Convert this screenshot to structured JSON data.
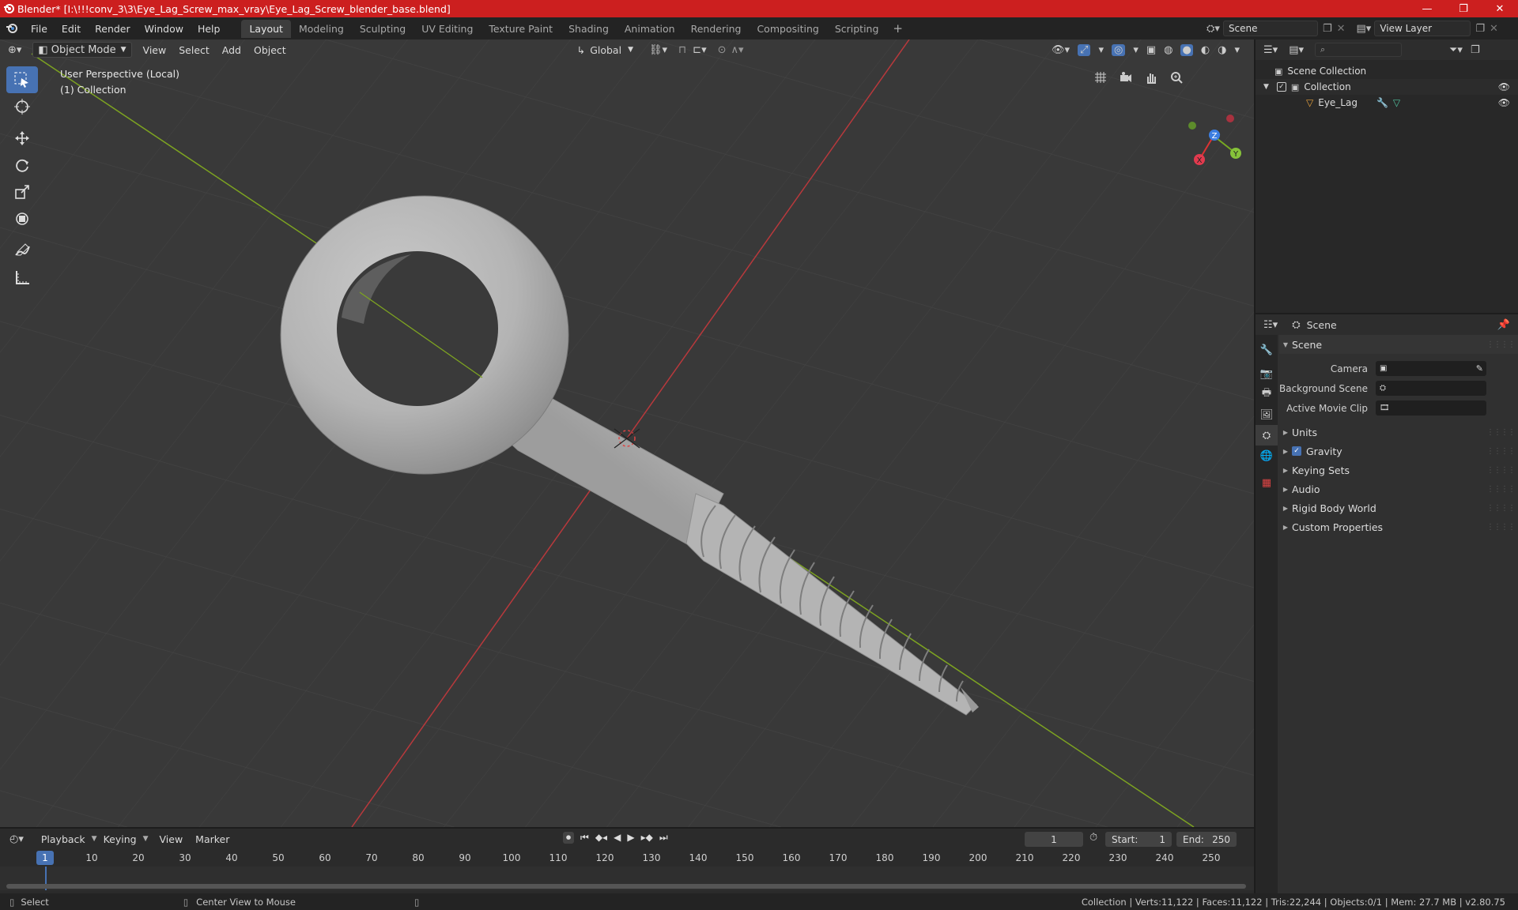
{
  "window": {
    "title": "Blender* [I:\\!!!conv_3\\3\\Eye_Lag_Screw_max_vray\\Eye_Lag_Screw_blender_base.blend]",
    "controls": [
      "—",
      "❐",
      "✕"
    ]
  },
  "menubar": {
    "menus": [
      "File",
      "Edit",
      "Render",
      "Window",
      "Help"
    ],
    "workspaces": [
      "Layout",
      "Modeling",
      "Sculpting",
      "UV Editing",
      "Texture Paint",
      "Shading",
      "Animation",
      "Rendering",
      "Compositing",
      "Scripting"
    ],
    "active_workspace": "Layout",
    "scene": "Scene",
    "view_layer": "View Layer"
  },
  "viewport": {
    "mode": "Object Mode",
    "menus": [
      "View",
      "Select",
      "Add",
      "Object"
    ],
    "orientation": "Global",
    "info_line1": "User Perspective (Local)",
    "info_line2": "(1) Collection",
    "gizmo": {
      "x": "X",
      "y": "Y",
      "z": "Z"
    }
  },
  "tools": [
    "select-box",
    "cursor",
    "move",
    "rotate",
    "scale",
    "transform",
    "annotate",
    "measure"
  ],
  "outliner": {
    "root": "Scene Collection",
    "collection": "Collection",
    "object": "Eye_Lag"
  },
  "properties": {
    "context": "Scene",
    "panel": "Scene",
    "fields": [
      {
        "label": "Camera",
        "value": ""
      },
      {
        "label": "Background Scene",
        "value": ""
      },
      {
        "label": "Active Movie Clip",
        "value": ""
      }
    ],
    "subpanels": [
      "Units",
      "Gravity",
      "Keying Sets",
      "Audio",
      "Rigid Body World",
      "Custom Properties"
    ],
    "gravity_checked": true
  },
  "timeline": {
    "menus": [
      "Playback",
      "Keying",
      "View",
      "Marker"
    ],
    "current_frame": "1",
    "start_label": "Start:",
    "start": "1",
    "end_label": "End:",
    "end": "250",
    "ruler": [
      "1",
      "10",
      "20",
      "30",
      "40",
      "50",
      "60",
      "70",
      "80",
      "90",
      "100",
      "110",
      "120",
      "130",
      "140",
      "150",
      "160",
      "170",
      "180",
      "190",
      "200",
      "210",
      "220",
      "230",
      "240",
      "250"
    ]
  },
  "statusbar": {
    "left1": "Select",
    "left2": "Center View to Mouse",
    "right": "Collection | Verts:11,122 | Faces:11,122 | Tris:22,244 | Objects:0/1 | Mem: 27.7 MB | v2.80.75"
  }
}
